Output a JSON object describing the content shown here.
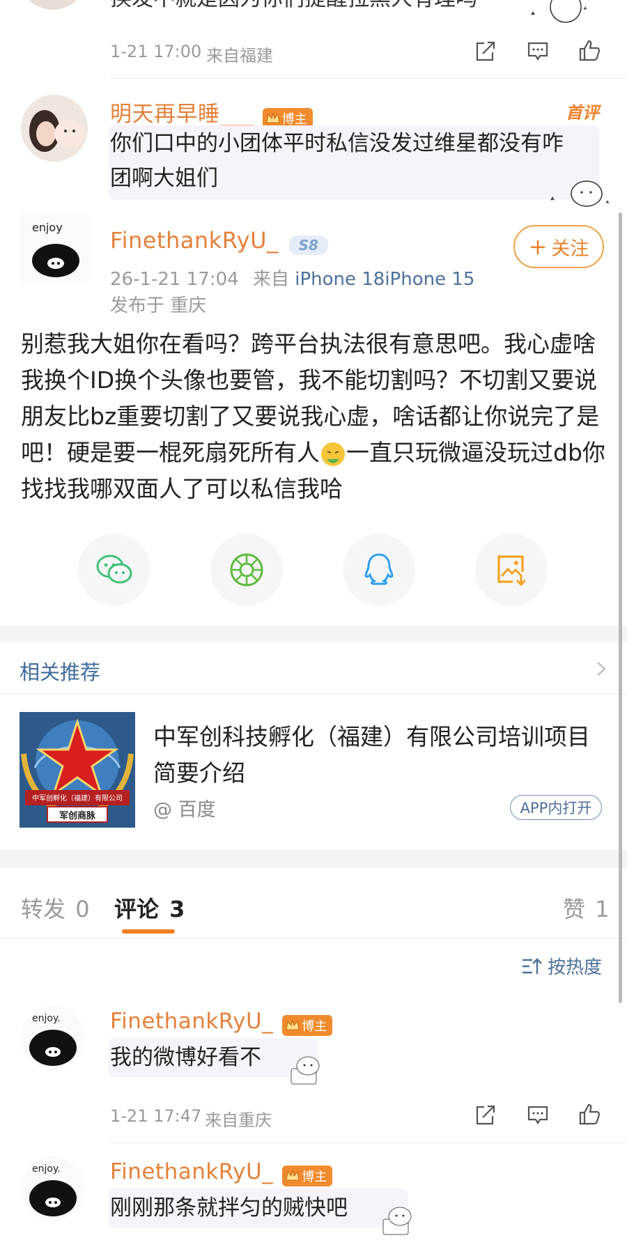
{
  "top_comment": {
    "partial_text": "换发不就是因为你们提醒拉黑人有理吗",
    "time": "1-21 17:00",
    "location": "来自福建"
  },
  "hot_comment": {
    "username": "明天再早睡___",
    "badge": "博主",
    "first_tag": "首评",
    "text_line1": "你们口中的小团体平时私信没发过维星都没有咋",
    "text_line2": "团啊大姐们"
  },
  "post": {
    "username": "FinethankRyU_",
    "vip_level": "S8",
    "date": "26-1-21 17:04",
    "source_prefix": "来自",
    "source_device": "iPhone 18iPhone 15",
    "published_at": "发布于 重庆",
    "follow_label": "关注",
    "body_part1": "别惹我大姐你在看吗？跨平台执法很有意思吧。我心虚啥我换个ID换个头像也要管，我不能切割吗？不切割又要说朋友比bz重要切割了又要说我心虚，啥话都让你说完了是吧！硬是要一棍死扇死所有人",
    "body_emoji": "sick-emoji",
    "body_part2": "一直只玩微逼没玩过db你找找我哪双面人了可以私信我哈"
  },
  "share_icons": [
    "wechat-icon",
    "moments-icon",
    "qq-icon",
    "save-image-icon"
  ],
  "recommendation": {
    "section_title": "相关推荐",
    "headline": "中军创科技孵化（福建）有限公司培训项目简要介绍",
    "source": "@ 百度",
    "open_app": "APP内打开",
    "thumb_caption": "中军创孵化（福建）有限公司",
    "thumb_brand": "军创商脉"
  },
  "tabs": {
    "repost_label": "转发",
    "repost_count": "0",
    "comment_label": "评论",
    "comment_count": "3",
    "like_label": "赞",
    "like_count": "1"
  },
  "sort_label": "按热度",
  "comments": [
    {
      "username": "FinethankRyU_",
      "badge": "博主",
      "text": "我的微博好看不",
      "time": "1-21 17:47",
      "location": "来自重庆"
    },
    {
      "username": "FinethankRyU_",
      "badge": "博主",
      "text": "刚刚那条就拌匀的贼快吧"
    }
  ],
  "colors": {
    "username": "#e4813a",
    "badge": "#f08a2c",
    "link_blue": "#3f6c9c",
    "tab_underline": "#f07e1f",
    "wechat_green": "#3fc27a"
  }
}
